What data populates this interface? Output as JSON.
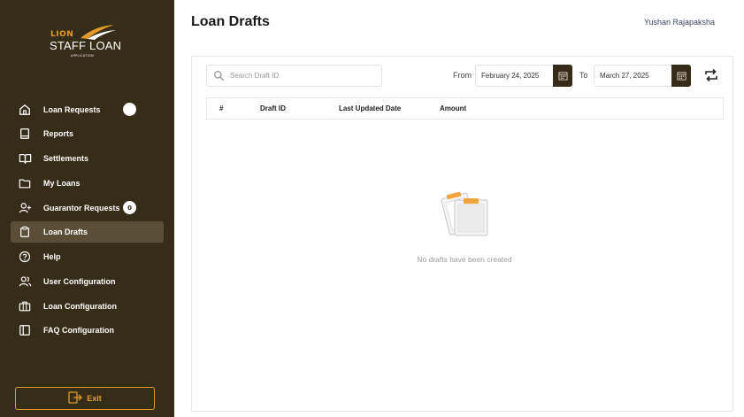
{
  "brand": {
    "lion": "LION",
    "staff_loan": "STAFF LOAN",
    "subtitle": "APPLICATION"
  },
  "sidebar": {
    "items": [
      {
        "label": "Loan Requests",
        "icon": "home-icon",
        "badge": ""
      },
      {
        "label": "Reports",
        "icon": "book-icon"
      },
      {
        "label": "Settlements",
        "icon": "open-book-icon"
      },
      {
        "label": "My Loans",
        "icon": "folder-icon"
      },
      {
        "label": "Guarantor Requests",
        "icon": "user-plus-icon",
        "badge": "0"
      },
      {
        "label": "Loan Drafts",
        "icon": "clipboard-icon",
        "active": true
      },
      {
        "label": "Help",
        "icon": "help-circle-icon"
      },
      {
        "label": "User Configuration",
        "icon": "users-icon"
      },
      {
        "label": "Loan Configuration",
        "icon": "briefcase-icon"
      },
      {
        "label": "FAQ Configuration",
        "icon": "columns-icon"
      }
    ],
    "exit_label": "Exit"
  },
  "header": {
    "title": "Loan Drafts",
    "user": "Yushan Rajapaksha"
  },
  "filters": {
    "search_placeholder": "Search Draft ID",
    "from_label": "From",
    "from_value": "February 24, 2025",
    "to_label": "To",
    "to_value": "March 27, 2025"
  },
  "table": {
    "columns": [
      "#",
      "Draft ID",
      "Last Updated Date",
      "Amount"
    ],
    "rows": []
  },
  "empty_state": {
    "message": "No drafts have been created"
  },
  "colors": {
    "sidebar_bg": "#362d18",
    "accent": "#e39a2b",
    "active_item": "#5a4f36"
  }
}
